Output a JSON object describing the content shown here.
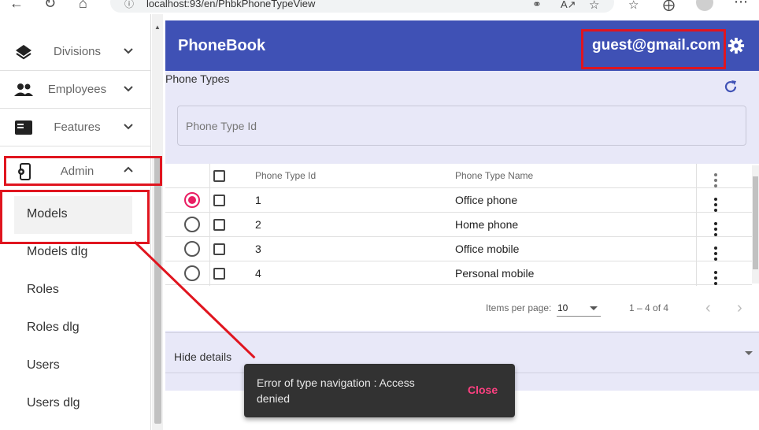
{
  "browser": {
    "url": "localhost:93/en/PhbkPhoneTypeView"
  },
  "sidebar": {
    "items": [
      {
        "label": "Divisions"
      },
      {
        "label": "Employees"
      },
      {
        "label": "Features"
      },
      {
        "label": "Admin"
      }
    ],
    "admin_subitems": [
      {
        "label": "Models"
      },
      {
        "label": "Models dlg"
      },
      {
        "label": "Roles"
      },
      {
        "label": "Roles dlg"
      },
      {
        "label": "Users"
      },
      {
        "label": "Users dlg"
      }
    ]
  },
  "header": {
    "title": "PhoneBook",
    "user": "guest@gmail.com"
  },
  "main": {
    "section_title": "Phone Types",
    "filter_placeholder": "Phone Type Id",
    "columns": [
      "Phone Type Id",
      "Phone Type Name"
    ],
    "rows": [
      {
        "id": "1",
        "name": "Office phone",
        "selected": true
      },
      {
        "id": "2",
        "name": "Home phone",
        "selected": false
      },
      {
        "id": "3",
        "name": "Office mobile",
        "selected": false
      },
      {
        "id": "4",
        "name": "Personal mobile",
        "selected": false
      }
    ],
    "paginator": {
      "items_per_page_label": "Items per page:",
      "items_per_page": "10",
      "range": "1 – 4 of 4"
    },
    "details_label": "Hide details"
  },
  "snackbar": {
    "message": "Error of type navigation : Access denied",
    "action": "Close"
  },
  "colors": {
    "primary": "#3f51b5",
    "accent": "#e91e63",
    "annotation": "#e0151f"
  }
}
